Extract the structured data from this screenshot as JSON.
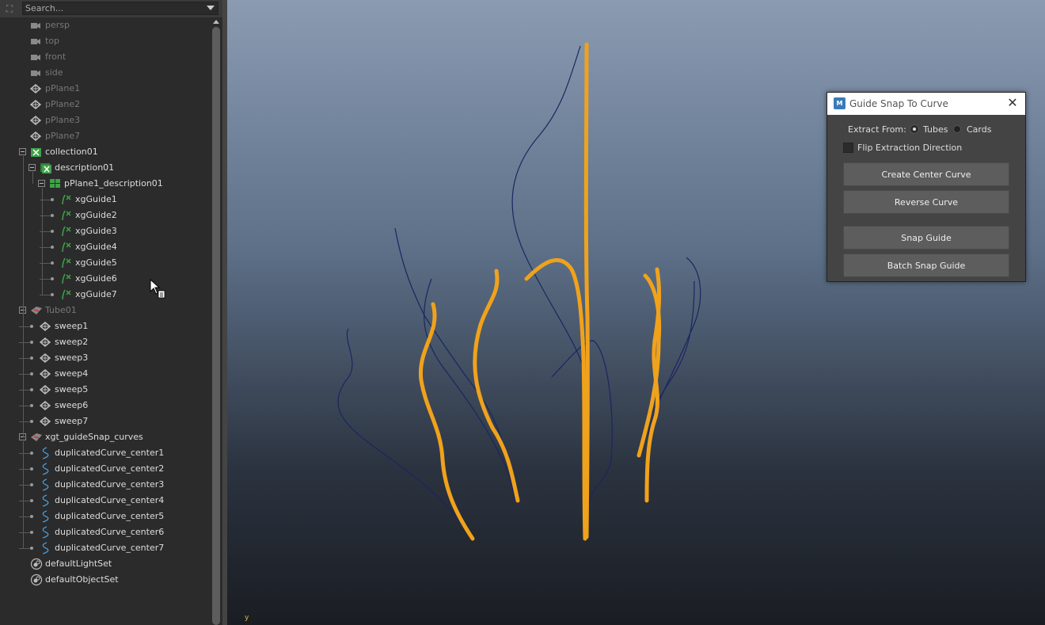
{
  "outliner": {
    "search_placeholder": "Search...",
    "items": [
      {
        "label": "persp",
        "depth": 0,
        "icon": "camera-icon",
        "dim": true
      },
      {
        "label": "top",
        "depth": 0,
        "icon": "camera-icon",
        "dim": true
      },
      {
        "label": "front",
        "depth": 0,
        "icon": "camera-icon",
        "dim": true
      },
      {
        "label": "side",
        "depth": 0,
        "icon": "camera-icon",
        "dim": true
      },
      {
        "label": "pPlane1",
        "depth": 0,
        "icon": "mesh-icon",
        "dim": true
      },
      {
        "label": "pPlane2",
        "depth": 0,
        "icon": "mesh-icon",
        "dim": true
      },
      {
        "label": "pPlane3",
        "depth": 0,
        "icon": "mesh-icon",
        "dim": true
      },
      {
        "label": "pPlane7",
        "depth": 0,
        "icon": "mesh-icon",
        "dim": true
      },
      {
        "label": "collection01",
        "depth": 0,
        "icon": "xgen-collection-icon",
        "dim": false,
        "expander": true
      },
      {
        "label": "description01",
        "depth": 1,
        "icon": "xgen-description-icon",
        "dim": false,
        "expander": true
      },
      {
        "label": "pPlane1_description01",
        "depth": 2,
        "icon": "xgen-patch-icon",
        "dim": false,
        "expander": true
      },
      {
        "label": "xgGuide1",
        "depth": 3,
        "icon": "xgen-guide-icon",
        "dim": false
      },
      {
        "label": "xgGuide2",
        "depth": 3,
        "icon": "xgen-guide-icon",
        "dim": false
      },
      {
        "label": "xgGuide3",
        "depth": 3,
        "icon": "xgen-guide-icon",
        "dim": false
      },
      {
        "label": "xgGuide4",
        "depth": 3,
        "icon": "xgen-guide-icon",
        "dim": false
      },
      {
        "label": "xgGuide5",
        "depth": 3,
        "icon": "xgen-guide-icon",
        "dim": false
      },
      {
        "label": "xgGuide6",
        "depth": 3,
        "icon": "xgen-guide-icon",
        "dim": false
      },
      {
        "label": "xgGuide7",
        "depth": 3,
        "icon": "xgen-guide-icon",
        "dim": false
      },
      {
        "label": "Tube01",
        "depth": 0,
        "icon": "group-icon",
        "dim": true,
        "expander": true
      },
      {
        "label": "sweep1",
        "depth": 1,
        "icon": "mesh-icon",
        "dim": false
      },
      {
        "label": "sweep2",
        "depth": 1,
        "icon": "mesh-icon",
        "dim": false
      },
      {
        "label": "sweep3",
        "depth": 1,
        "icon": "mesh-icon",
        "dim": false
      },
      {
        "label": "sweep4",
        "depth": 1,
        "icon": "mesh-icon",
        "dim": false
      },
      {
        "label": "sweep5",
        "depth": 1,
        "icon": "mesh-icon",
        "dim": false
      },
      {
        "label": "sweep6",
        "depth": 1,
        "icon": "mesh-icon",
        "dim": false
      },
      {
        "label": "sweep7",
        "depth": 1,
        "icon": "mesh-icon",
        "dim": false
      },
      {
        "label": "xgt_guideSnap_curves",
        "depth": 0,
        "icon": "group-icon",
        "dim": false,
        "expander": true
      },
      {
        "label": "duplicatedCurve_center1",
        "depth": 1,
        "icon": "curve-icon",
        "dim": false
      },
      {
        "label": "duplicatedCurve_center2",
        "depth": 1,
        "icon": "curve-icon",
        "dim": false
      },
      {
        "label": "duplicatedCurve_center3",
        "depth": 1,
        "icon": "curve-icon",
        "dim": false
      },
      {
        "label": "duplicatedCurve_center4",
        "depth": 1,
        "icon": "curve-icon",
        "dim": false
      },
      {
        "label": "duplicatedCurve_center5",
        "depth": 1,
        "icon": "curve-icon",
        "dim": false
      },
      {
        "label": "duplicatedCurve_center6",
        "depth": 1,
        "icon": "curve-icon",
        "dim": false
      },
      {
        "label": "duplicatedCurve_center7",
        "depth": 1,
        "icon": "curve-icon",
        "dim": false
      },
      {
        "label": "defaultLightSet",
        "depth": 0,
        "icon": "set-icon",
        "dim": false
      },
      {
        "label": "defaultObjectSet",
        "depth": 0,
        "icon": "set-icon",
        "dim": false
      }
    ]
  },
  "viewport": {
    "axis_label": "y"
  },
  "dialog": {
    "app_icon": "M",
    "title": "Guide Snap To Curve",
    "extract_label": "Extract From:",
    "option_tubes": "Tubes",
    "option_cards": "Cards",
    "selected_option": "Tubes",
    "flip_label": "Flip Extraction Direction",
    "flip_checked": false,
    "buttons": {
      "create_center_curve": "Create Center Curve",
      "reverse_curve": "Reverse Curve",
      "snap_guide": "Snap Guide",
      "batch_snap_guide": "Batch Snap Guide"
    }
  },
  "colors": {
    "tube_orange": "#f0a21c",
    "guide_navy": "#1a2660",
    "xgen_green": "#3fa14a"
  }
}
